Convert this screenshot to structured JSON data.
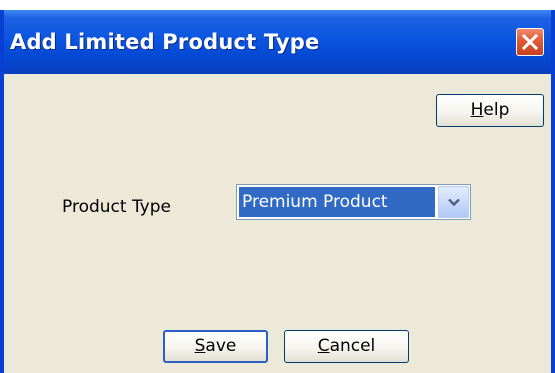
{
  "dialog": {
    "title": "Add Limited Product Type",
    "help_button": {
      "prefix": "",
      "accel": "H",
      "rest": "elp"
    },
    "form": {
      "product_type_label": "Product Type",
      "product_type_value": "Premium Product"
    },
    "save_button": {
      "accel": "S",
      "rest": "ave"
    },
    "cancel_button": {
      "accel": "C",
      "rest": "ancel"
    }
  },
  "icons": {
    "close": "close-icon",
    "dropdown": "chevron-down-icon"
  },
  "colors": {
    "titlebar": "#0b55e0",
    "close_button": "#e05a35",
    "dialog_background": "#ece9d8",
    "selection": "#316ac5"
  }
}
